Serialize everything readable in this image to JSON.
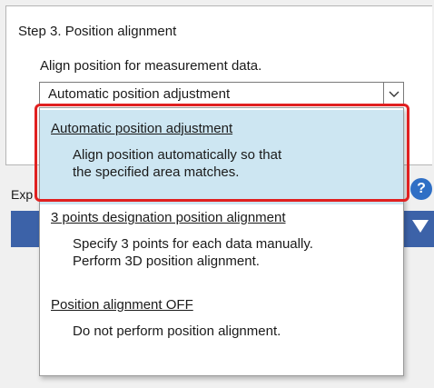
{
  "step": {
    "title": "Step 3. Position alignment",
    "description": "Align position for measurement data."
  },
  "combo": {
    "selected": "Automatic position adjustment",
    "arrow_icon": "chevron-down-icon"
  },
  "behind": {
    "label": "Exp",
    "help_icon": "?"
  },
  "dropdown": {
    "options": [
      {
        "title": "Automatic position adjustment",
        "desc": "Align position automatically so that\nthe specified area matches.",
        "highlighted": true
      },
      {
        "title": "3 points designation position alignment",
        "desc": "Specify 3 points for each data manually.\nPerform 3D position alignment.",
        "highlighted": false
      },
      {
        "title": "Position alignment OFF",
        "desc": "Do not perform position alignment.",
        "highlighted": false
      }
    ]
  },
  "colors": {
    "highlight": "#cde6f2",
    "callout": "#e02020",
    "accent_blue": "#3c62a8"
  }
}
